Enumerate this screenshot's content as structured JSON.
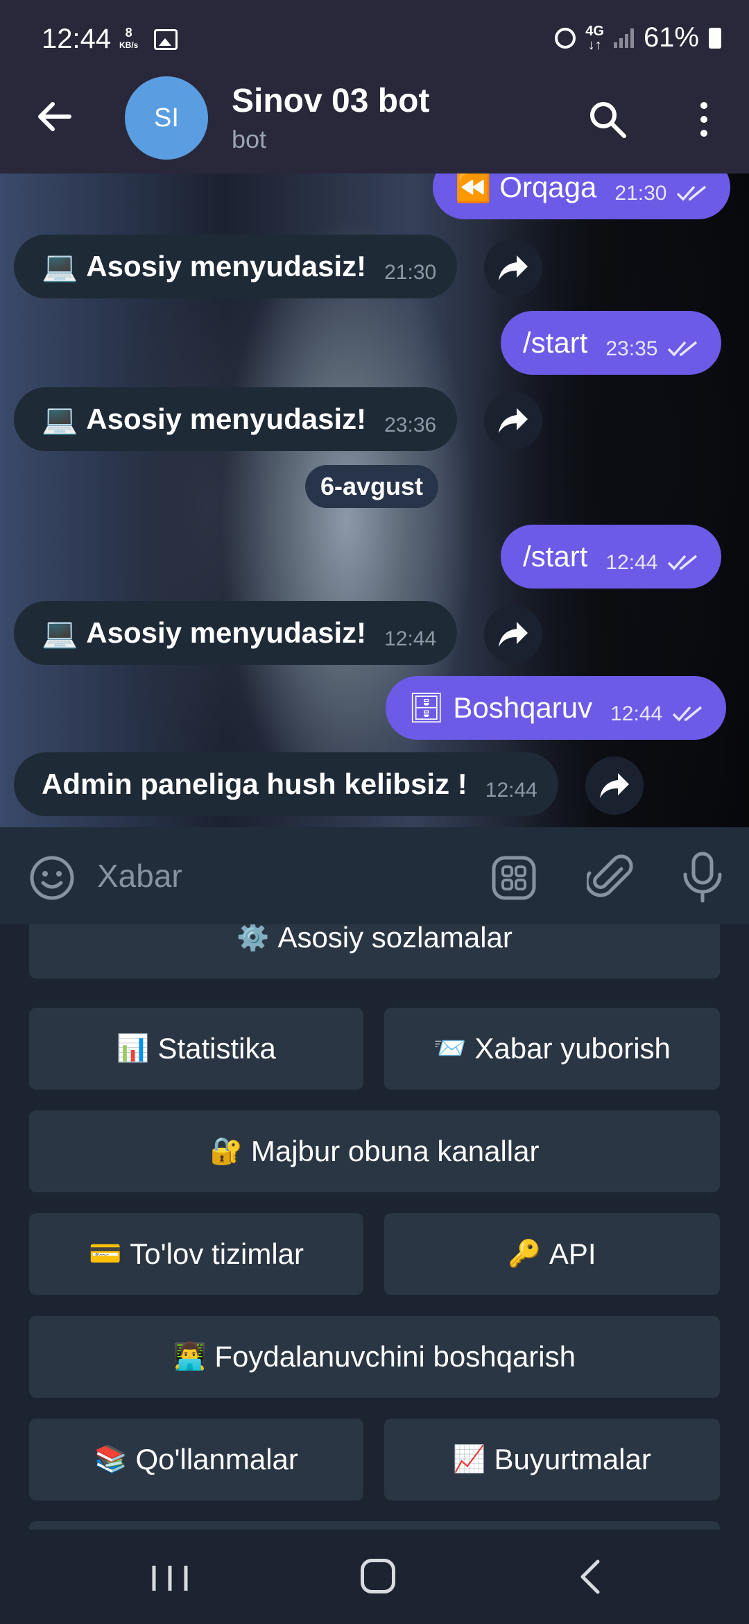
{
  "status_bar": {
    "time": "12:44",
    "speed_value": "8",
    "speed_unit": "KB/s",
    "network": "4G",
    "battery": "61%"
  },
  "header": {
    "avatar_initials": "SI",
    "title": "Sinov 03 bot",
    "subtitle": "bot"
  },
  "messages": [
    {
      "dir": "out",
      "emoji": "⏪",
      "text": "Orqaga",
      "time": "21:30"
    },
    {
      "dir": "in",
      "emoji": "💻",
      "text": "Asosiy menyudasiz!",
      "time": "21:30"
    },
    {
      "dir": "out",
      "text": "/start",
      "time": "23:35"
    },
    {
      "dir": "in",
      "emoji": "💻",
      "text": "Asosiy menyudasiz!",
      "time": "23:36"
    },
    {
      "dir": "out",
      "text": "/start",
      "time": "12:44"
    },
    {
      "dir": "in",
      "emoji": "💻",
      "text": "Asosiy menyudasiz!",
      "time": "12:44"
    },
    {
      "dir": "out",
      "emoji": "🗄",
      "text": "Boshqaruv",
      "time": "12:44"
    },
    {
      "dir": "in",
      "text": "Admin paneliga hush kelibsiz !",
      "time": "12:44"
    }
  ],
  "date_separator": "6-avgust",
  "input": {
    "placeholder": "Xabar"
  },
  "keyboard": [
    {
      "icon": "⚙️",
      "label": "Asosiy sozlamalar"
    },
    {
      "icon": "📊",
      "label": "Statistika"
    },
    {
      "icon": "📨",
      "label": "Xabar yuborish"
    },
    {
      "icon": "🔐",
      "label": "Majbur obuna kanallar"
    },
    {
      "icon": "💳",
      "label": "To'lov tizimlar"
    },
    {
      "icon": "🔑",
      "label": "API"
    },
    {
      "icon": "👨‍💻",
      "label": "Foydalanuvchini boshqarish"
    },
    {
      "icon": "📚",
      "label": "Qo'llanmalar"
    },
    {
      "icon": "📈",
      "label": "Buyurtmalar"
    }
  ],
  "colors": {
    "outgoing_bubble": "#6b5be6",
    "incoming_bubble": "#1f2a37",
    "avatar": "#5a9de0",
    "keyboard_button": "#2b3644"
  }
}
